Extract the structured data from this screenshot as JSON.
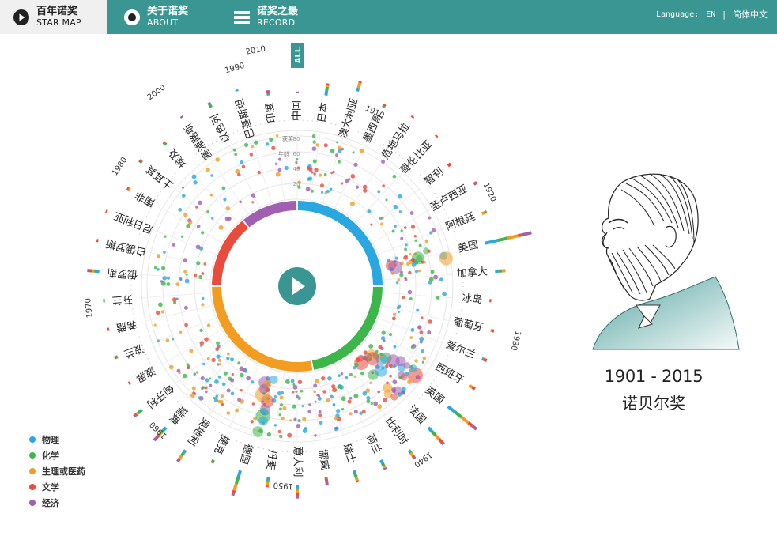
{
  "nav": {
    "star_map": {
      "zh": "百年诺奖",
      "en": "STAR MAP"
    },
    "about": {
      "zh": "关于诺奖",
      "en": "ABOUT"
    },
    "record": {
      "zh": "诺奖之最",
      "en": "RECORD"
    }
  },
  "language": {
    "label": "Language:",
    "en": "EN",
    "separator": "|",
    "zh": "简体中文"
  },
  "all_tab": "ALL",
  "radar_scale": {
    "awards_label": "获奖",
    "age_label": "年龄",
    "ticks": [
      "80",
      "60",
      "40",
      "20"
    ]
  },
  "year_ticks": [
    {
      "year": "1910",
      "angle": 24
    },
    {
      "year": "1920",
      "angle": 64
    },
    {
      "year": "1930",
      "angle": 104
    },
    {
      "year": "1940",
      "angle": 144
    },
    {
      "year": "1950",
      "angle": 184
    },
    {
      "year": "1960",
      "angle": 224
    },
    {
      "year": "1970",
      "angle": 264
    },
    {
      "year": "1980",
      "angle": 304
    },
    {
      "year": "1990",
      "angle": 344
    },
    {
      "year": "2000",
      "angle": 24
    },
    {
      "year": "2010",
      "angle": 64
    }
  ],
  "countries": [
    {
      "name": "中国",
      "bar": [
        [
          "#a05fb0",
          1
        ]
      ]
    },
    {
      "name": "日本",
      "bar": [
        [
          "#2aa7e1",
          3
        ],
        [
          "#3cb54a",
          2
        ],
        [
          "#f39c22",
          1
        ],
        [
          "#e94b3c",
          1
        ]
      ]
    },
    {
      "name": "澳大利亚",
      "bar": [
        [
          "#2aa7e1",
          2
        ],
        [
          "#f39c22",
          3
        ],
        [
          "#e94b3c",
          1
        ]
      ]
    },
    {
      "name": "墨西哥",
      "bar": [
        [
          "#3cb54a",
          1
        ],
        [
          "#e94b3c",
          1
        ]
      ]
    },
    {
      "name": "危地马拉",
      "bar": [
        [
          "#e94b3c",
          1
        ]
      ]
    },
    {
      "name": "哥伦比亚",
      "bar": [
        [
          "#e94b3c",
          1
        ]
      ]
    },
    {
      "name": "智利",
      "bar": [
        [
          "#e94b3c",
          2
        ]
      ]
    },
    {
      "name": "圣卢西亚",
      "bar": [
        [
          "#a05fb0",
          1
        ],
        [
          "#e94b3c",
          1
        ]
      ]
    },
    {
      "name": "阿根廷",
      "bar": [
        [
          "#f39c22",
          2
        ],
        [
          "#3cb54a",
          1
        ]
      ]
    },
    {
      "name": "美国",
      "bar": [
        [
          "#2aa7e1",
          10
        ],
        [
          "#3cb54a",
          8
        ],
        [
          "#f39c22",
          9
        ],
        [
          "#e94b3c",
          3
        ],
        [
          "#a05fb0",
          8
        ]
      ]
    },
    {
      "name": "加拿大",
      "bar": [
        [
          "#2aa7e1",
          2
        ],
        [
          "#3cb54a",
          2
        ],
        [
          "#f39c22",
          2
        ]
      ]
    },
    {
      "name": "冰岛",
      "bar": [
        [
          "#e94b3c",
          1
        ]
      ]
    },
    {
      "name": "葡萄牙",
      "bar": [
        [
          "#f39c22",
          1
        ],
        [
          "#e94b3c",
          1
        ]
      ]
    },
    {
      "name": "爱尔兰",
      "bar": [
        [
          "#2aa7e1",
          1
        ],
        [
          "#e94b3c",
          2
        ]
      ]
    },
    {
      "name": "西班牙",
      "bar": [
        [
          "#f39c22",
          2
        ],
        [
          "#e94b3c",
          2
        ]
      ]
    },
    {
      "name": "英国",
      "bar": [
        [
          "#2aa7e1",
          5
        ],
        [
          "#3cb54a",
          5
        ],
        [
          "#f39c22",
          5
        ],
        [
          "#e94b3c",
          3
        ],
        [
          "#a05fb0",
          3
        ]
      ]
    },
    {
      "name": "法国",
      "bar": [
        [
          "#2aa7e1",
          3
        ],
        [
          "#3cb54a",
          3
        ],
        [
          "#f39c22",
          3
        ],
        [
          "#e94b3c",
          3
        ],
        [
          "#a05fb0",
          1
        ]
      ]
    },
    {
      "name": "比利时",
      "bar": [
        [
          "#2aa7e1",
          1
        ],
        [
          "#3cb54a",
          1
        ],
        [
          "#f39c22",
          2
        ],
        [
          "#e94b3c",
          1
        ],
        [
          "#a05fb0",
          1
        ]
      ]
    },
    {
      "name": "荷兰",
      "bar": [
        [
          "#2aa7e1",
          2
        ],
        [
          "#3cb54a",
          2
        ],
        [
          "#f39c22",
          1
        ],
        [
          "#a05fb0",
          1
        ]
      ]
    },
    {
      "name": "瑞士",
      "bar": [
        [
          "#2aa7e1",
          2
        ],
        [
          "#3cb54a",
          2
        ],
        [
          "#f39c22",
          2
        ],
        [
          "#e94b3c",
          1
        ]
      ]
    },
    {
      "name": "挪威",
      "bar": [
        [
          "#3cb54a",
          1
        ],
        [
          "#e94b3c",
          2
        ],
        [
          "#a05fb0",
          2
        ]
      ]
    },
    {
      "name": "意大利",
      "bar": [
        [
          "#2aa7e1",
          2
        ],
        [
          "#3cb54a",
          1
        ],
        [
          "#f39c22",
          2
        ],
        [
          "#e94b3c",
          2
        ],
        [
          "#a05fb0",
          1
        ]
      ]
    },
    {
      "name": "丹麦",
      "bar": [
        [
          "#2aa7e1",
          2
        ],
        [
          "#3cb54a",
          1
        ],
        [
          "#f39c22",
          2
        ],
        [
          "#e94b3c",
          1
        ]
      ]
    },
    {
      "name": "德国",
      "bar": [
        [
          "#2aa7e1",
          4
        ],
        [
          "#3cb54a",
          4
        ],
        [
          "#f39c22",
          4
        ],
        [
          "#e94b3c",
          2
        ],
        [
          "#a05fb0",
          1
        ]
      ]
    },
    {
      "name": "捷克",
      "bar": [
        [
          "#3cb54a",
          1
        ],
        [
          "#e94b3c",
          1
        ]
      ]
    },
    {
      "name": "奥地利",
      "bar": [
        [
          "#2aa7e1",
          2
        ],
        [
          "#3cb54a",
          2
        ],
        [
          "#f39c22",
          2
        ],
        [
          "#e94b3c",
          1
        ],
        [
          "#a05fb0",
          1
        ]
      ]
    },
    {
      "name": "瑞典",
      "bar": [
        [
          "#2aa7e1",
          2
        ],
        [
          "#3cb54a",
          2
        ],
        [
          "#f39c22",
          2
        ],
        [
          "#e94b3c",
          2
        ],
        [
          "#a05fb0",
          2
        ]
      ]
    },
    {
      "name": "匈牙利",
      "bar": [
        [
          "#2aa7e1",
          1
        ],
        [
          "#3cb54a",
          2
        ],
        [
          "#f39c22",
          1
        ],
        [
          "#e94b3c",
          1
        ],
        [
          "#a05fb0",
          1
        ]
      ]
    },
    {
      "name": "波黑",
      "bar": [
        [
          "#e94b3c",
          1
        ]
      ]
    },
    {
      "name": "波兰",
      "bar": [
        [
          "#3cb54a",
          1
        ],
        [
          "#e94b3c",
          1
        ]
      ]
    },
    {
      "name": "希腊",
      "bar": [
        [
          "#e94b3c",
          1
        ]
      ]
    },
    {
      "name": "芬兰",
      "bar": [
        [
          "#3cb54a",
          1
        ]
      ]
    },
    {
      "name": "俄罗斯",
      "bar": [
        [
          "#2aa7e1",
          2
        ],
        [
          "#3cb54a",
          1
        ],
        [
          "#f39c22",
          1
        ],
        [
          "#e94b3c",
          2
        ],
        [
          "#a05fb0",
          1
        ]
      ]
    },
    {
      "name": "白俄罗斯",
      "bar": [
        [
          "#e94b3c",
          1
        ]
      ]
    },
    {
      "name": "尼日利亚",
      "bar": [
        [
          "#e94b3c",
          1
        ]
      ]
    },
    {
      "name": "南非",
      "bar": [
        [
          "#f39c22",
          1
        ],
        [
          "#e94b3c",
          1
        ]
      ]
    },
    {
      "name": "土耳其",
      "bar": [
        [
          "#3cb54a",
          1
        ],
        [
          "#e94b3c",
          1
        ]
      ]
    },
    {
      "name": "埃及",
      "bar": [
        [
          "#3cb54a",
          1
        ],
        [
          "#e94b3c",
          1
        ]
      ]
    },
    {
      "name": "塞浦路斯",
      "bar": [
        [
          "#a05fb0",
          1
        ]
      ]
    },
    {
      "name": "以色列",
      "bar": [
        [
          "#3cb54a",
          2
        ],
        [
          "#a05fb0",
          1
        ]
      ]
    },
    {
      "name": "巴基斯坦",
      "bar": [
        [
          "#2aa7e1",
          1
        ]
      ]
    },
    {
      "name": "印度",
      "bar": [
        [
          "#2aa7e1",
          1
        ],
        [
          "#e94b3c",
          1
        ],
        [
          "#a05fb0",
          1
        ]
      ]
    }
  ],
  "donut": [
    {
      "category": "物理",
      "color": "#2aa7e1",
      "share": 0.25
    },
    {
      "category": "化学",
      "color": "#3cb54a",
      "share": 0.22
    },
    {
      "category": "生理或医药",
      "color": "#f39c22",
      "share": 0.28
    },
    {
      "category": "文学",
      "color": "#e94b3c",
      "share": 0.14
    },
    {
      "category": "经济",
      "color": "#a05fb0",
      "share": 0.11
    }
  ],
  "legend": [
    {
      "label": "物理",
      "color": "#2aa7e1"
    },
    {
      "label": "化学",
      "color": "#3cb54a"
    },
    {
      "label": "生理或医药",
      "color": "#f39c22"
    },
    {
      "label": "文学",
      "color": "#e94b3c"
    },
    {
      "label": "经济",
      "color": "#a05fb0"
    }
  ],
  "years_title": "1901 - 2015",
  "prize_title": "诺贝尔奖",
  "colors": {
    "teal": "#3a9692",
    "physics": "#2aa7e1",
    "chemistry": "#3cb54a",
    "medicine": "#f39c22",
    "literature": "#e94b3c",
    "economics": "#a05fb0"
  }
}
